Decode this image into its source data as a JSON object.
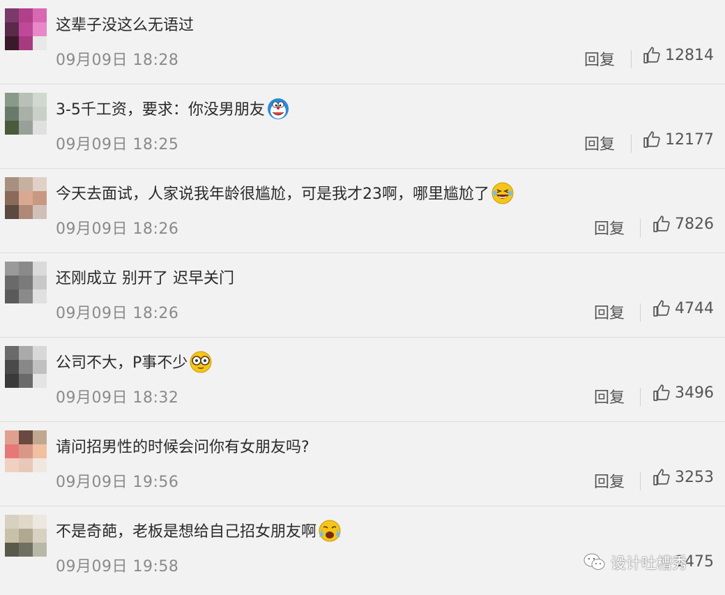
{
  "comments": [
    {
      "text": "这辈子没这么无语过",
      "time": "09月09日 18:28",
      "reply": "回复",
      "likes": "12814",
      "emoji": ""
    },
    {
      "text": "3-5千工资，要求：你没男朋友",
      "time": "09月09日 18:25",
      "reply": "回复",
      "likes": "12177",
      "emoji": "doraemon-emoji"
    },
    {
      "text": "今天去面试，人家说我年龄很尴尬，可是我才23啊，哪里尴尬了",
      "time": "09月09日 18:26",
      "reply": "回复",
      "likes": "7826",
      "emoji": "laugh-cry-emoji"
    },
    {
      "text": "还刚成立 别开了 迟早关门",
      "time": "09月09日 18:26",
      "reply": "回复",
      "likes": "4744",
      "emoji": ""
    },
    {
      "text": "公司不大，P事不少",
      "time": "09月09日 18:32",
      "reply": "回复",
      "likes": "3496",
      "emoji": "glasses-emoji"
    },
    {
      "text": "请问招男性的时候会问你有女朋友吗?",
      "time": "09月09日 19:56",
      "reply": "回复",
      "likes": "3253",
      "emoji": ""
    },
    {
      "text": "不是奇葩，老板是想给自己招女朋友啊",
      "time": "09月09日 19:58",
      "reply": "回复",
      "likes": "1475",
      "emoji": "crying-laugh-emoji"
    }
  ],
  "watermark": {
    "text": "设计吐槽秀",
    "icon": "wechat-icon"
  },
  "colors": {
    "background": "#f2f2f2",
    "divider": "#dcdcdc",
    "time": "#8a8a8a",
    "text": "#2a2a2a"
  }
}
